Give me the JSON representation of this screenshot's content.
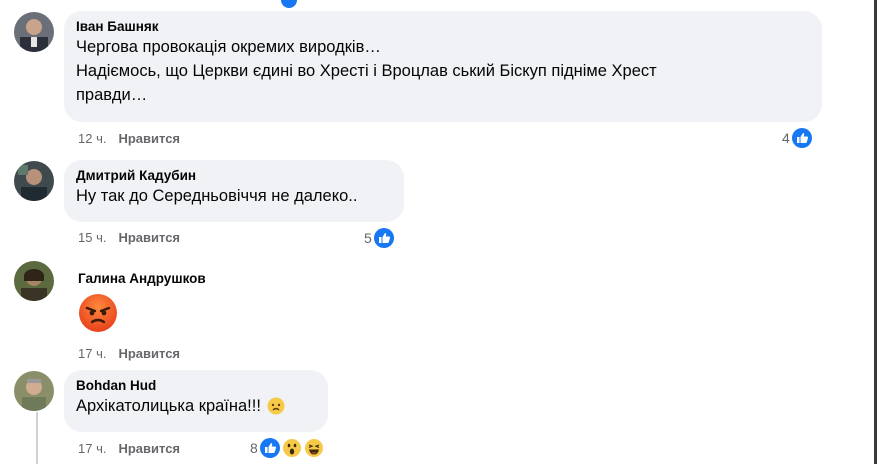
{
  "comments": [
    {
      "author": "Іван Башняк",
      "lines": [
        "Чергова провокація окремих виродків…",
        "Надіємось, що Церкви єдині во Хресті і Вроцлав ський Біскуп підніме Хрест",
        "правди…"
      ],
      "time": "12 ч.",
      "like_label": "Нравится",
      "reactions": "4",
      "reaction_icons": [
        "like-icon"
      ]
    },
    {
      "author": "Дмитрий Кадубин",
      "lines": [
        "Ну так до Середньовіччя не далеко.."
      ],
      "time": "15 ч.",
      "like_label": "Нравится",
      "reactions": "5",
      "reaction_icons": [
        "like-icon"
      ]
    },
    {
      "author": "Галина Андрушков",
      "lines": [],
      "emoji": "angry-face-emoji",
      "time": "17 ч.",
      "like_label": "Нравится"
    },
    {
      "author": "Bohdan Hud",
      "lines": [
        "Архікатолицька країна!!!"
      ],
      "inline_emoji": "sad-face-emoji",
      "time": "17 ч.",
      "like_label": "Нравится",
      "reactions": "8",
      "reaction_icons": [
        "like-icon",
        "wow-icon",
        "haha-icon"
      ]
    }
  ],
  "colors": {
    "bubble": "#f0f2f5",
    "meta_text": "#65676b",
    "like_blue": "#1877f2",
    "angry_orange": "#f05a28"
  }
}
